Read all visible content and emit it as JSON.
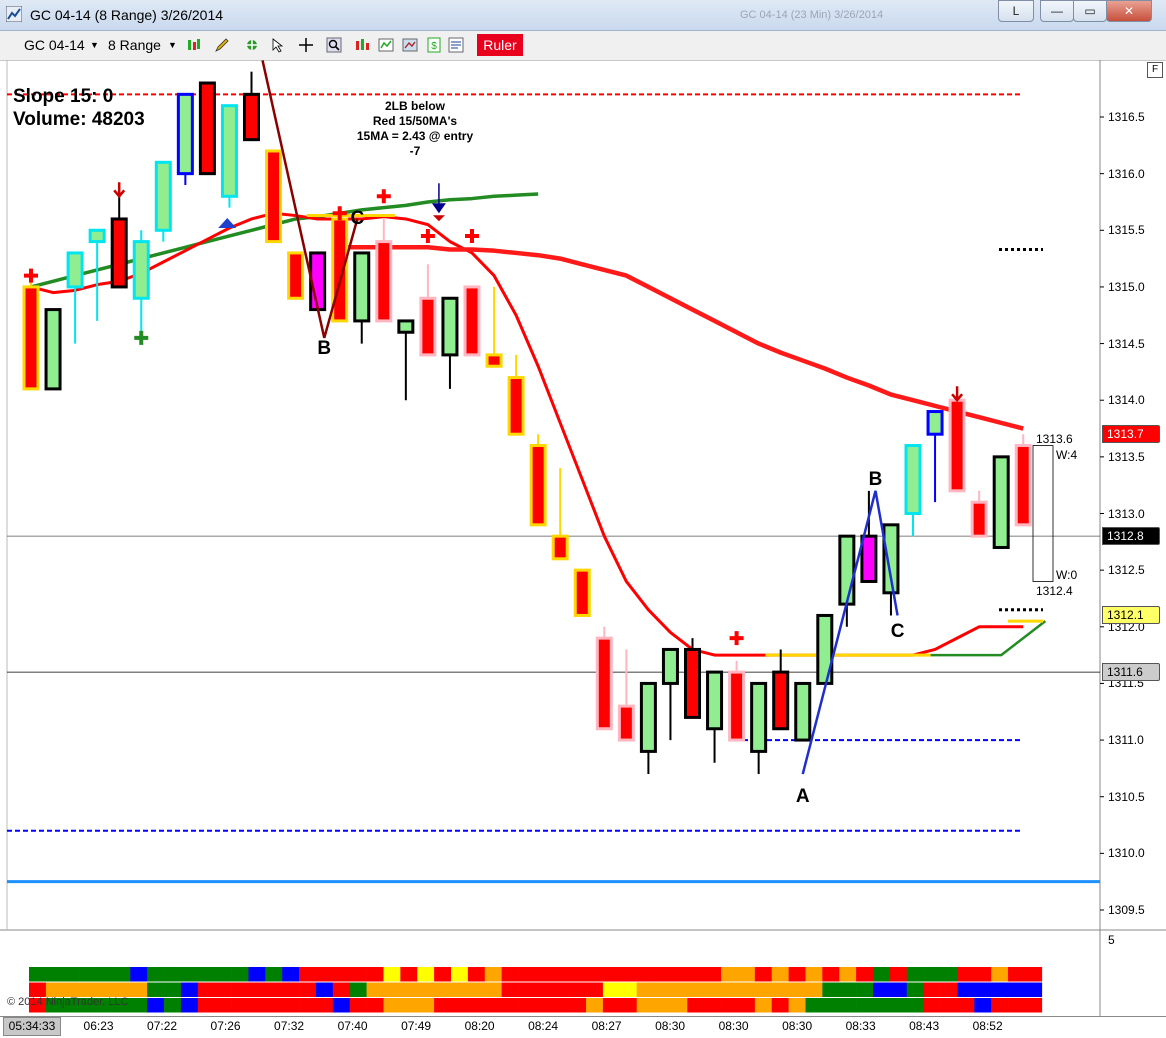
{
  "window": {
    "title": "GC 04-14 (8 Range)  3/26/2014",
    "ghost_title": "GC 04-14 (23 Min)  3/26/2014",
    "btn_l": "L",
    "btn_min": "—",
    "btn_max": "▭",
    "btn_close": "✕"
  },
  "toolbar": {
    "instrument": "GC 04-14",
    "interval": "8 Range",
    "ruler": "Ruler"
  },
  "info": {
    "slope": "Slope 15: 0",
    "volume": "Volume: 48203"
  },
  "note": [
    "2LB below",
    "Red 15/50MA's",
    "15MA = 2.43 @ entry",
    "-7"
  ],
  "pattern_labels": [
    {
      "text": "B",
      "x": 16.5,
      "y": 1314.45
    },
    {
      "text": "C",
      "x": 19.5,
      "y": 1315.6
    },
    {
      "text": "A",
      "x": 45.5,
      "y": 1310.5
    },
    {
      "text": "B",
      "x": 49.5,
      "y": 1313.3
    },
    {
      "text": "C",
      "x": 50.5,
      "y": 1311.95
    }
  ],
  "ohlc_annotation": {
    "high": "1313.6",
    "low": "1312.4",
    "w_top": "W:4",
    "w_bottom": "W:0"
  },
  "copyright": "© 2014 NinjaTrader, LLC",
  "current_time": "05:34:33",
  "f_button": "F",
  "panel_label": "5",
  "colors": {
    "up_fill": "#90ee90",
    "down_fill": "#ff0000",
    "magenta": "#ff00ff",
    "ma15": "#ff0000",
    "ma50": "#ff1a1a",
    "ma_fast": "#228b22",
    "blue_line": "#1e90ff",
    "yellow": "#ffd700"
  },
  "chart_data": {
    "type": "candlestick",
    "ylim": [
      1309.3,
      1316.9
    ],
    "y_ticks": [
      "1309.5",
      "1310.0",
      "1310.5",
      "1311.0",
      "1311.5",
      "1312.0",
      "1312.5",
      "1313.0",
      "1313.5",
      "1314.0",
      "1314.5",
      "1315.0",
      "1315.5",
      "1316.0",
      "1316.5"
    ],
    "x_tick_labels": [
      {
        "bar": 3.5,
        "label": "06:23"
      },
      {
        "bar": 7.5,
        "label": "07:22"
      },
      {
        "bar": 11.5,
        "label": "07:26"
      },
      {
        "bar": 15.5,
        "label": "07:32"
      },
      {
        "bar": 19.5,
        "label": "07:40"
      },
      {
        "bar": 23.5,
        "label": "07:49"
      },
      {
        "bar": 27.5,
        "label": "08:20"
      },
      {
        "bar": 31.5,
        "label": "08:24"
      },
      {
        "bar": 35.5,
        "label": "08:27"
      },
      {
        "bar": 39.5,
        "label": "08:30"
      },
      {
        "bar": 43.5,
        "label": "08:30"
      },
      {
        "bar": 47.5,
        "label": "08:30"
      },
      {
        "bar": 51.5,
        "label": "08:33"
      },
      {
        "bar": 55.5,
        "label": "08:43"
      },
      {
        "bar": 59.5,
        "label": "08:52"
      }
    ],
    "candles": [
      {
        "o": 1315.0,
        "h": 1315.1,
        "l": 1314.1,
        "c": 1314.1,
        "color": "red",
        "border": "yellow"
      },
      {
        "o": 1314.1,
        "h": 1314.8,
        "l": 1314.1,
        "c": 1314.8,
        "color": "green",
        "border": "black"
      },
      {
        "o": 1315.0,
        "h": 1315.3,
        "l": 1314.5,
        "c": 1315.3,
        "color": "green",
        "border": "cyan"
      },
      {
        "o": 1315.4,
        "h": 1315.5,
        "l": 1314.7,
        "c": 1315.5,
        "color": "green",
        "border": "cyan"
      },
      {
        "o": 1315.6,
        "h": 1315.8,
        "l": 1315.0,
        "c": 1315.0,
        "color": "red",
        "border": "black"
      },
      {
        "o": 1314.9,
        "h": 1315.5,
        "l": 1314.6,
        "c": 1315.4,
        "color": "green",
        "border": "cyan"
      },
      {
        "o": 1315.5,
        "h": 1316.1,
        "l": 1315.4,
        "c": 1316.1,
        "color": "green",
        "border": "cyan"
      },
      {
        "o": 1316.0,
        "h": 1316.7,
        "l": 1315.9,
        "c": 1316.7,
        "color": "green",
        "border": "blue"
      },
      {
        "o": 1316.8,
        "h": 1316.8,
        "l": 1316.0,
        "c": 1316.0,
        "color": "red",
        "border": "black"
      },
      {
        "o": 1315.8,
        "h": 1316.6,
        "l": 1315.7,
        "c": 1316.6,
        "color": "green",
        "border": "cyan"
      },
      {
        "o": 1316.7,
        "h": 1316.9,
        "l": 1316.3,
        "c": 1316.3,
        "color": "red",
        "border": "black"
      },
      {
        "o": 1316.2,
        "h": 1316.2,
        "l": 1315.4,
        "c": 1315.4,
        "color": "red",
        "border": "yellow"
      },
      {
        "o": 1315.3,
        "h": 1315.3,
        "l": 1314.9,
        "c": 1314.9,
        "color": "red",
        "border": "yellow"
      },
      {
        "o": 1315.3,
        "h": 1315.3,
        "l": 1314.8,
        "c": 1314.8,
        "color": "magenta",
        "border": "black"
      },
      {
        "o": 1315.6,
        "h": 1315.6,
        "l": 1314.7,
        "c": 1314.7,
        "color": "red",
        "border": "yellow"
      },
      {
        "o": 1314.7,
        "h": 1315.3,
        "l": 1314.5,
        "c": 1315.3,
        "color": "green",
        "border": "black"
      },
      {
        "o": 1315.4,
        "h": 1315.6,
        "l": 1314.7,
        "c": 1314.7,
        "color": "red",
        "border": "pink"
      },
      {
        "o": 1314.6,
        "h": 1314.7,
        "l": 1314.0,
        "c": 1314.7,
        "color": "green",
        "border": "black"
      },
      {
        "o": 1314.9,
        "h": 1315.2,
        "l": 1314.4,
        "c": 1314.4,
        "color": "red",
        "border": "pink"
      },
      {
        "o": 1314.4,
        "h": 1314.9,
        "l": 1314.1,
        "c": 1314.9,
        "color": "green",
        "border": "black"
      },
      {
        "o": 1315.0,
        "h": 1315.0,
        "l": 1314.4,
        "c": 1314.4,
        "color": "red",
        "border": "pink"
      },
      {
        "o": 1314.4,
        "h": 1315.0,
        "l": 1314.3,
        "c": 1314.3,
        "color": "red",
        "border": "yellow"
      },
      {
        "o": 1314.2,
        "h": 1314.4,
        "l": 1313.7,
        "c": 1313.7,
        "color": "red",
        "border": "yellow"
      },
      {
        "o": 1313.6,
        "h": 1313.7,
        "l": 1312.9,
        "c": 1312.9,
        "color": "red",
        "border": "yellow"
      },
      {
        "o": 1312.8,
        "h": 1313.4,
        "l": 1312.6,
        "c": 1312.6,
        "color": "red",
        "border": "yellow"
      },
      {
        "o": 1312.5,
        "h": 1312.5,
        "l": 1312.1,
        "c": 1312.1,
        "color": "red",
        "border": "yellow"
      },
      {
        "o": 1311.9,
        "h": 1312.0,
        "l": 1311.1,
        "c": 1311.1,
        "color": "red",
        "border": "pink"
      },
      {
        "o": 1311.3,
        "h": 1311.8,
        "l": 1311.0,
        "c": 1311.0,
        "color": "red",
        "border": "pink"
      },
      {
        "o": 1310.9,
        "h": 1311.5,
        "l": 1310.7,
        "c": 1311.5,
        "color": "green",
        "border": "black"
      },
      {
        "o": 1311.5,
        "h": 1311.8,
        "l": 1311.0,
        "c": 1311.8,
        "color": "green",
        "border": "black"
      },
      {
        "o": 1311.8,
        "h": 1311.9,
        "l": 1311.2,
        "c": 1311.2,
        "color": "red",
        "border": "black"
      },
      {
        "o": 1311.1,
        "h": 1311.6,
        "l": 1310.8,
        "c": 1311.6,
        "color": "green",
        "border": "black"
      },
      {
        "o": 1311.6,
        "h": 1311.7,
        "l": 1311.0,
        "c": 1311.0,
        "color": "red",
        "border": "pink"
      },
      {
        "o": 1310.9,
        "h": 1311.5,
        "l": 1310.7,
        "c": 1311.5,
        "color": "green",
        "border": "black"
      },
      {
        "o": 1311.6,
        "h": 1311.8,
        "l": 1311.1,
        "c": 1311.1,
        "color": "red",
        "border": "black"
      },
      {
        "o": 1311.0,
        "h": 1311.5,
        "l": 1311.0,
        "c": 1311.5,
        "color": "green",
        "border": "black"
      },
      {
        "o": 1311.5,
        "h": 1312.1,
        "l": 1311.5,
        "c": 1312.1,
        "color": "green",
        "border": "black"
      },
      {
        "o": 1312.2,
        "h": 1312.8,
        "l": 1312.0,
        "c": 1312.8,
        "color": "green",
        "border": "black"
      },
      {
        "o": 1312.8,
        "h": 1313.2,
        "l": 1312.4,
        "c": 1312.4,
        "color": "magenta",
        "border": "black"
      },
      {
        "o": 1312.3,
        "h": 1312.9,
        "l": 1312.1,
        "c": 1312.9,
        "color": "green",
        "border": "black"
      },
      {
        "o": 1313.0,
        "h": 1313.6,
        "l": 1312.8,
        "c": 1313.6,
        "color": "green",
        "border": "cyan"
      },
      {
        "o": 1313.7,
        "h": 1313.9,
        "l": 1313.1,
        "c": 1313.9,
        "color": "green",
        "border": "blue"
      },
      {
        "o": 1314.0,
        "h": 1314.0,
        "l": 1313.2,
        "c": 1313.2,
        "color": "red",
        "border": "pink"
      },
      {
        "o": 1313.1,
        "h": 1313.2,
        "l": 1312.8,
        "c": 1312.8,
        "color": "red",
        "border": "pink"
      },
      {
        "o": 1312.7,
        "h": 1313.5,
        "l": 1312.7,
        "c": 1313.5,
        "color": "green",
        "border": "black"
      },
      {
        "o": 1313.6,
        "h": 1313.7,
        "l": 1312.9,
        "c": 1312.9,
        "color": "red",
        "border": "pink"
      }
    ],
    "ma15": [
      1315.0,
      1314.95,
      1314.97,
      1315.02,
      1315.05,
      1315.12,
      1315.22,
      1315.32,
      1315.42,
      1315.52,
      1315.6,
      1315.65,
      1315.63,
      1315.6,
      1315.6,
      1315.6,
      1315.62,
      1315.6,
      1315.55,
      1315.4,
      1315.3,
      1315.1,
      1314.75,
      1314.3,
      1313.8,
      1313.3,
      1312.8,
      1312.4,
      1312.15,
      1311.95,
      1311.8,
      1311.75,
      1311.75,
      1311.75,
      1311.75,
      1311.75,
      1311.75,
      1311.75,
      1311.75,
      1311.75,
      1311.75,
      1311.8,
      1311.9,
      1312.0,
      1312.0,
      1312.0
    ],
    "ma50": [
      1315.35,
      1315.35,
      1315.35,
      1315.35,
      1315.35,
      1315.33,
      1315.33,
      1315.32,
      1315.3,
      1315.28,
      1315.25,
      1315.2,
      1315.15,
      1315.1,
      1315.0,
      1314.9,
      1314.8,
      1314.7,
      1314.6,
      1314.5,
      1314.42,
      1314.35,
      1314.28,
      1314.2,
      1314.13,
      1314.05,
      1314.0,
      1313.95,
      1313.9,
      1313.85,
      1313.8,
      1313.75
    ],
    "ma_fast": [
      1315.0,
      1315.05,
      1315.1,
      1315.15,
      1315.2,
      1315.25,
      1315.3,
      1315.35,
      1315.4,
      1315.45,
      1315.5,
      1315.55,
      1315.6,
      1315.62,
      1315.65,
      1315.68,
      1315.7,
      1315.72,
      1315.75,
      1315.77,
      1315.78,
      1315.8,
      1315.81,
      1315.82
    ],
    "hlines": [
      {
        "y": 1316.7,
        "color": "#ff0000",
        "style": "dash"
      },
      {
        "y": 1310.2,
        "color": "#0000ff",
        "style": "dash"
      },
      {
        "y": 1309.75,
        "color": "#1e90ff",
        "style": "solid"
      },
      {
        "y": 1312.8,
        "color": "#555",
        "style": "thin"
      },
      {
        "y": 1311.6,
        "color": "#000",
        "style": "thin"
      }
    ],
    "price_tags": [
      {
        "y": 1313.7,
        "text": "1313.7",
        "bg": "#ff0000",
        "fg": "#fff"
      },
      {
        "y": 1312.8,
        "text": "1312.8",
        "bg": "#000",
        "fg": "#fff"
      },
      {
        "y": 1312.1,
        "text": "1312.1",
        "bg": "#ffff66",
        "fg": "#000"
      },
      {
        "y": 1311.6,
        "text": "1311.6",
        "bg": "#ccc",
        "fg": "#000"
      }
    ],
    "bottom_panel_rows": [
      [
        "#008000",
        "#008000",
        "#008000",
        "#008000",
        "#008000",
        "#008000",
        "#0000ff",
        "#008000",
        "#008000",
        "#008000",
        "#008000",
        "#008000",
        "#008000",
        "#0000ff",
        "#008000",
        "#0000ff",
        "#ff0000",
        "#ff0000",
        "#ff0000",
        "#ff0000",
        "#ff0000",
        "#ffff00",
        "#ff0000",
        "#ffff00",
        "#ff0000",
        "#ffff00",
        "#ff0000",
        "#ffa500",
        "#ff0000",
        "#ff0000",
        "#ff0000",
        "#ff0000",
        "#ff0000",
        "#ff0000",
        "#ff0000",
        "#ff0000",
        "#ff0000",
        "#ff0000",
        "#ff0000",
        "#ff0000",
        "#ff0000",
        "#ffa500",
        "#ffa500",
        "#ff0000",
        "#ffa500",
        "#ff0000",
        "#ffa500",
        "#ff0000",
        "#ffa500",
        "#ff0000",
        "#008000",
        "#ff0000",
        "#008000",
        "#008000",
        "#008000",
        "#ff0000",
        "#ff0000",
        "#ffa500",
        "#ff0000",
        "#ff0000"
      ],
      [
        "#ff0000",
        "#ffa500",
        "#ffa500",
        "#ffa500",
        "#ffa500",
        "#ffa500",
        "#ffa500",
        "#008000",
        "#008000",
        "#0000ff",
        "#ff0000",
        "#ff0000",
        "#ff0000",
        "#ff0000",
        "#ff0000",
        "#ff0000",
        "#ff0000",
        "#0000ff",
        "#ff0000",
        "#008000",
        "#ffa500",
        "#ffa500",
        "#ffa500",
        "#ffa500",
        "#ffa500",
        "#ffa500",
        "#ffa500",
        "#ffa500",
        "#ff0000",
        "#ff0000",
        "#ff0000",
        "#ff0000",
        "#ff0000",
        "#ff0000",
        "#ffff00",
        "#ffff00",
        "#ffa500",
        "#ffa500",
        "#ffa500",
        "#ffa500",
        "#ffa500",
        "#ffa500",
        "#ffa500",
        "#ffa500",
        "#ffa500",
        "#ffa500",
        "#ffa500",
        "#008000",
        "#008000",
        "#008000",
        "#0000ff",
        "#0000ff",
        "#008000",
        "#ff0000",
        "#ff0000",
        "#0000ff",
        "#0000ff",
        "#0000ff",
        "#0000ff",
        "#0000ff"
      ],
      [
        "#ff0000",
        "#008000",
        "#008000",
        "#008000",
        "#008000",
        "#008000",
        "#008000",
        "#0000ff",
        "#008000",
        "#0000ff",
        "#ff0000",
        "#ff0000",
        "#ff0000",
        "#ff0000",
        "#ff0000",
        "#ff0000",
        "#ff0000",
        "#ff0000",
        "#0000ff",
        "#ff0000",
        "#ff0000",
        "#ffa500",
        "#ffa500",
        "#ffa500",
        "#ff0000",
        "#ff0000",
        "#ff0000",
        "#ff0000",
        "#ff0000",
        "#ff0000",
        "#ff0000",
        "#ff0000",
        "#ff0000",
        "#ffa500",
        "#ff0000",
        "#ff0000",
        "#ffa500",
        "#ffa500",
        "#ffa500",
        "#ff0000",
        "#ff0000",
        "#ff0000",
        "#ff0000",
        "#ffa500",
        "#ff0000",
        "#ffa500",
        "#008000",
        "#008000",
        "#008000",
        "#008000",
        "#008000",
        "#008000",
        "#008000",
        "#ff0000",
        "#ff0000",
        "#ff0000",
        "#0000ff",
        "#ff0000",
        "#ff0000",
        "#ff0000"
      ]
    ]
  }
}
